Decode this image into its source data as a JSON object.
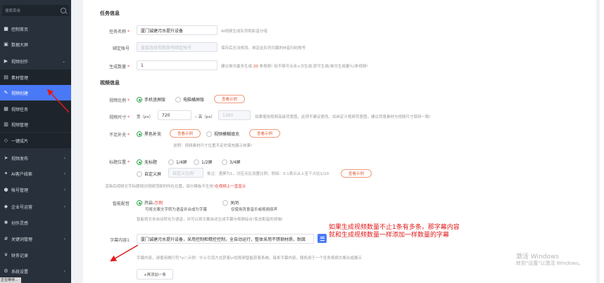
{
  "sidebar": {
    "search_placeholder": "搜索菜单",
    "items": [
      {
        "label": "控制首页",
        "icon": "dashboard-icon"
      },
      {
        "label": "数据大屏",
        "icon": "screen-icon"
      },
      {
        "label": "视频创作",
        "icon": "video-icon"
      },
      {
        "label": "素材管理",
        "icon": "folder-icon"
      },
      {
        "label": "视频创建",
        "icon": "pencil-icon"
      },
      {
        "label": "视频任务",
        "icon": "task-icon"
      },
      {
        "label": "视频管理",
        "icon": "list-icon"
      },
      {
        "label": "一键成片",
        "icon": "magic-icon"
      },
      {
        "label": "视频发布",
        "icon": "send-icon"
      },
      {
        "label": "AI客户线索",
        "icon": "lead-icon"
      },
      {
        "label": "帐号管理",
        "icon": "account-icon"
      },
      {
        "label": "企业号运营",
        "icon": "enterprise-icon"
      },
      {
        "label": "创作灵感",
        "icon": "idea-icon"
      },
      {
        "label": "关键词管理",
        "icon": "keyword-icon"
      },
      {
        "label": "财务记录",
        "icon": "finance-icon"
      },
      {
        "label": "系统设置",
        "icon": "settings-icon"
      }
    ],
    "footer": "正在等待..."
  },
  "task": {
    "section_title": "任务信息",
    "name_label": "任务名称",
    "name_value": "厦门诚建污水提升设备",
    "name_hint": "AI视频生成队列和影音分组",
    "account_label": "绑定账号",
    "account_placeholder": "直接选择视频发布绑定账号",
    "account_hint": "保存后无法修改。绑定此队列归属的M音扫码账号",
    "count_label": "生成数量",
    "count_value": "1",
    "count_hint_pre": "建议单次最多生成",
    "count_hint_num": "20",
    "count_hint_post": "条视频! 如不够可点击+次生成,即可生成(单次生成量%)条视频!"
  },
  "video": {
    "section_title": "视频信息",
    "ratio_label": "视频比例",
    "ratio_options": [
      "手机竖屏版",
      "电脑横屏版"
    ],
    "ratio_example": "查看示例",
    "size_label": "视频尺寸",
    "width_label": "宽（px）",
    "width_value": "720",
    "height_label": "-- 高（px）",
    "height_value": "1280",
    "size_hint": "如果使用视频高级背景图，此项不建议更改，如自定义视频背景图，建议背景素材与视频尺寸保持一致!",
    "fill_label": "不足补充",
    "fill_options": [
      "黑色补充",
      "视频模糊填充"
    ],
    "fill_example_1": "查看示例",
    "fill_example_2": "查看示例",
    "fill_note": "说明：视频素材尺寸位置不足时填充展示效果!",
    "title_pos_label": "标题位置",
    "title_pos_options": [
      "无标题",
      "1/4屏",
      "1/2屏",
      "3/4屏",
      "自定义屏"
    ],
    "title_pos_custom_placeholder": "自定义比例",
    "title_pos_hint": "批注：竖屏为1，对应点比设置比例，例如：0.1表示从上至下占比1/10",
    "title_pos_example": "查看示例",
    "title_pos_note_pre": "渲染后视频文字标题相对视频顶部的所在位置，部分模板不生效!",
    "title_pos_note_red": "在视频上一直显示",
    "voice_label": "智能配音",
    "voice_on_label": "开启-",
    "voice_on_example": "示例",
    "voice_on_desc": "可将文案文字转为语音并合成为字幕",
    "voice_off_label": "关闭",
    "voice_off_desc": "仅使用背景音乐或视频原声",
    "voice_note": "智能将文本自动转化为语音，并可以将文案自动生成字幕与视频综合!免去配音的烦恼!",
    "subtitle_label": "字幕内容1",
    "subtitle_value": "厦门诚建污水提升设备，采用控制柜精控控制，全自动运行，整体采用不锈钢材质，耐腐",
    "subtitle_hint": "字幕内容，请使用换行符\"\\n\",示例：什么引流方式获客\\n短视频智能获客系统。每条字幕内容，随机用于一个任务视频文案合成展示",
    "add_button": "+再添加一条"
  },
  "annotation": {
    "text": "如果生成视频数量不止1条有多条，那字幕内容就和生成视频数量一样添加一样数量的字幕"
  },
  "watermark": {
    "line1": "激活 Windows",
    "line2": "转到\"设置\"以激活 Windows。"
  },
  "colors": {
    "sidebar_bg": "#28303b",
    "active": "#4a79f7",
    "annotation": "#e11a1a",
    "radio_on": "#34a853",
    "example_border": "#f09a7c"
  }
}
